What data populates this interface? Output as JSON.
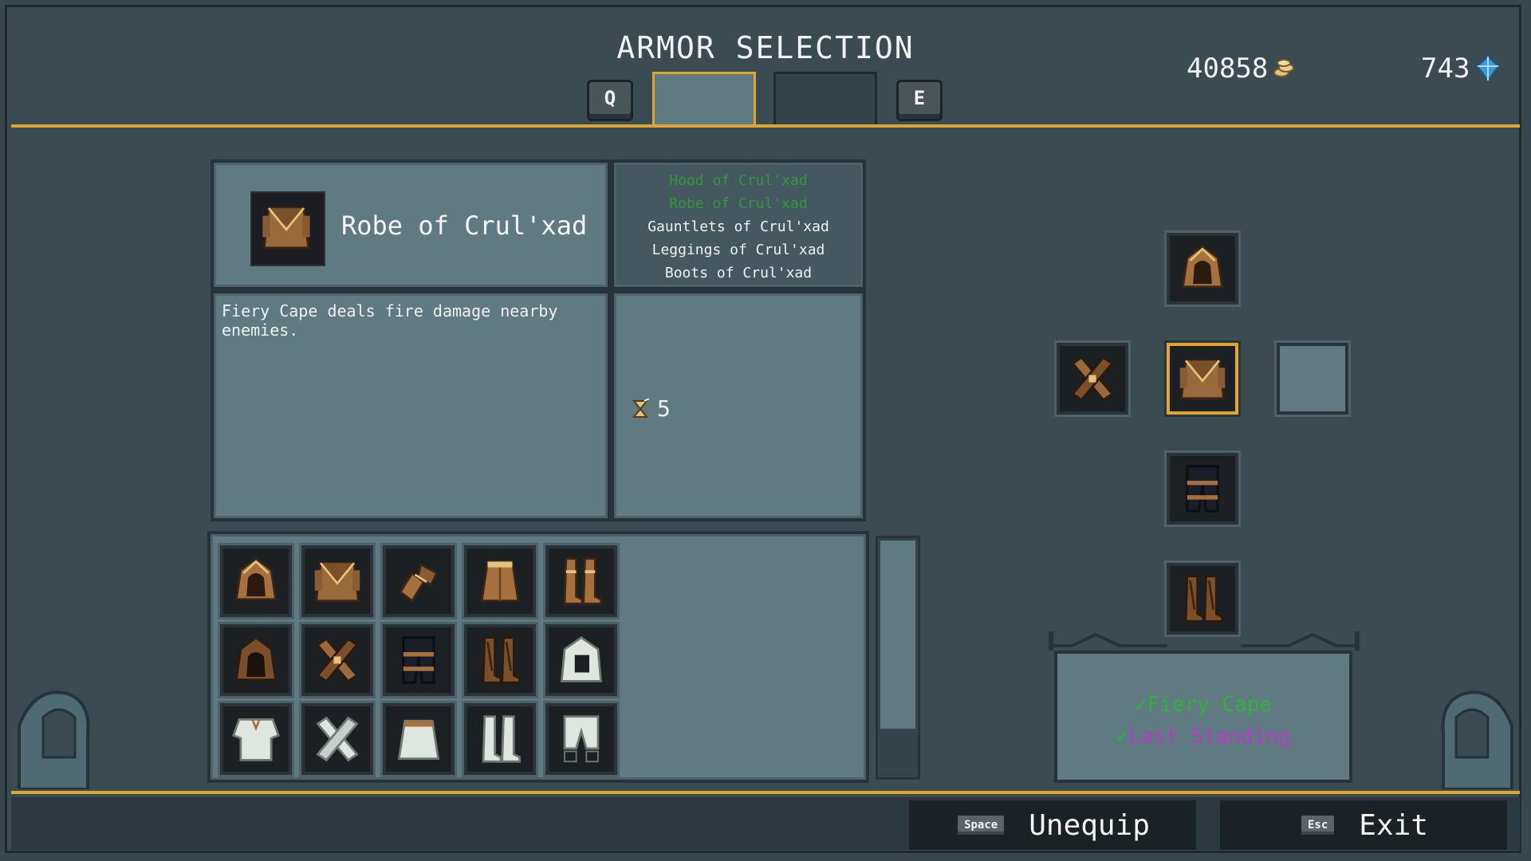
{
  "header": {
    "title": "ARMOR SELECTION",
    "prev_key": "Q",
    "next_key": "E",
    "gold": "40858",
    "gems": "743"
  },
  "item": {
    "name": "Robe of Crul'xad",
    "description": "Fiery Cape deals fire damage nearby enemies.",
    "cooldown": "5"
  },
  "set_pieces": [
    {
      "label": "Hood of Crul'xad",
      "owned": true
    },
    {
      "label": "Robe of Crul'xad",
      "owned": true
    },
    {
      "label": "Gauntlets of Crul'xad",
      "owned": false
    },
    {
      "label": "Leggings of Crul'xad",
      "owned": false
    },
    {
      "label": "Boots of Crul'xad",
      "owned": false
    }
  ],
  "perks": [
    {
      "label": "Fiery Cape",
      "color": "#2fb23c"
    },
    {
      "label": "Last Standing",
      "color": "#b43cc8"
    }
  ],
  "inventory": [
    [
      "hood-brown",
      "robe-brown",
      "gauntlet-brown",
      "skirt-brown",
      "boots-brown"
    ],
    [
      "hood-dark",
      "gloves-crossed-brown",
      "leggings-dark",
      "boots-dark",
      "hood-white"
    ],
    [
      "shirt-white",
      "gloves-white",
      "skirt-white",
      "boots-white",
      "pants-white"
    ]
  ],
  "equipped": {
    "head": "hood-brown",
    "hands": "gloves-crossed-brown",
    "body": "robe-brown",
    "trinket": "",
    "legs": "leggings-dark",
    "feet": "boots-dark"
  },
  "actions": {
    "unequip_key": "Space",
    "unequip_label": "Unequip",
    "exit_key": "Esc",
    "exit_label": "Exit"
  },
  "colors": {
    "accent": "#e0a531",
    "panel": "#5f7a81",
    "background": "#3a4b52",
    "set_owned": "#2f9a3a"
  }
}
